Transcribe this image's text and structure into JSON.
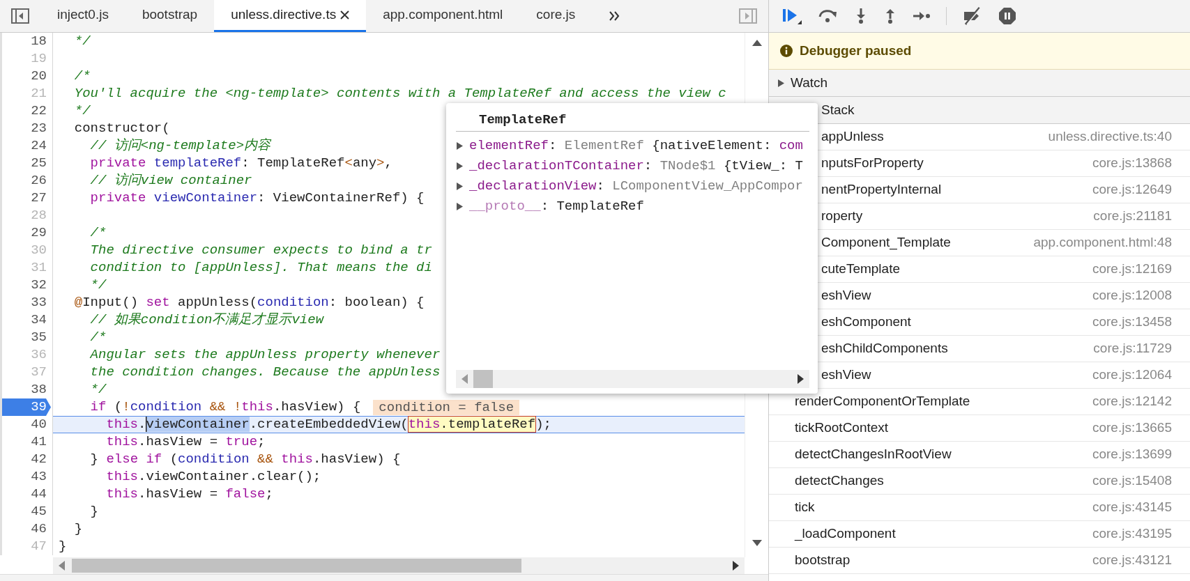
{
  "tabs": [
    {
      "label": "inject0.js",
      "selected": false,
      "closable": false
    },
    {
      "label": "bootstrap",
      "selected": false,
      "closable": false
    },
    {
      "label": "unless.directive.ts",
      "selected": true,
      "closable": true
    },
    {
      "label": "app.component.html",
      "selected": false,
      "closable": false
    },
    {
      "label": "core.js",
      "selected": false,
      "closable": false
    }
  ],
  "editor": {
    "lines": [
      {
        "number": "18",
        "breakable": true,
        "breakpoint": false,
        "paused_here": false,
        "tokens": [
          {
            "text": "  */",
            "kind": "comment"
          }
        ]
      },
      {
        "number": "19",
        "breakable": false,
        "breakpoint": false,
        "paused_here": false
      },
      {
        "number": "20",
        "breakable": true,
        "breakpoint": false,
        "paused_here": false,
        "tokens": [
          {
            "text": "  /*",
            "kind": "comment"
          }
        ]
      },
      {
        "number": "21",
        "breakable": false,
        "breakpoint": false,
        "paused_here": false,
        "tokens": [
          {
            "text": "  You'll acquire the <ng-template> contents with a TemplateRef and access the view c",
            "kind": "comment"
          }
        ]
      },
      {
        "number": "22",
        "breakable": true,
        "breakpoint": false,
        "paused_here": false,
        "tokens": [
          {
            "text": "  */",
            "kind": "comment"
          }
        ]
      },
      {
        "number": "23",
        "breakable": true,
        "breakpoint": false,
        "paused_here": false,
        "tokens": [
          {
            "text": "  constructor(",
            "kind": "plain"
          }
        ]
      },
      {
        "number": "24",
        "breakable": true,
        "breakpoint": false,
        "paused_here": false,
        "tokens": [
          {
            "text": "    // 访问<ng-template>内容",
            "kind": "comment"
          }
        ]
      },
      {
        "number": "25",
        "breakable": true,
        "breakpoint": false,
        "paused_here": false,
        "tokens": [
          {
            "text": "    private",
            "kind": "keyword"
          },
          {
            "text": " templateRef",
            "kind": "variable"
          },
          {
            "text": ": TemplateRef",
            "kind": "plain"
          },
          {
            "text": "<",
            "kind": "operator"
          },
          {
            "text": "any",
            "kind": "plain"
          },
          {
            "text": ">",
            "kind": "operator"
          },
          {
            "text": ",",
            "kind": "plain"
          }
        ]
      },
      {
        "number": "26",
        "breakable": true,
        "breakpoint": false,
        "paused_here": false,
        "tokens": [
          {
            "text": "    // 访问view container",
            "kind": "comment"
          }
        ]
      },
      {
        "number": "27",
        "breakable": true,
        "breakpoint": false,
        "paused_here": false,
        "tokens": [
          {
            "text": "    private",
            "kind": "keyword"
          },
          {
            "text": " viewContainer",
            "kind": "variable"
          },
          {
            "text": ": ViewContainerRef) {",
            "kind": "plain"
          }
        ]
      },
      {
        "number": "28",
        "breakable": false,
        "breakpoint": false,
        "paused_here": false
      },
      {
        "number": "29",
        "breakable": true,
        "breakpoint": false,
        "paused_here": false,
        "tokens": [
          {
            "text": "    /*",
            "kind": "comment"
          }
        ]
      },
      {
        "number": "30",
        "breakable": false,
        "breakpoint": false,
        "paused_here": false,
        "tokens": [
          {
            "text": "    The directive consumer expects to bind a tr",
            "kind": "comment"
          }
        ]
      },
      {
        "number": "31",
        "breakable": false,
        "breakpoint": false,
        "paused_here": false,
        "tokens": [
          {
            "text": "    condition to [appUnless]. That means the di",
            "kind": "comment"
          }
        ]
      },
      {
        "number": "32",
        "breakable": true,
        "breakpoint": false,
        "paused_here": false,
        "tokens": [
          {
            "text": "    */",
            "kind": "comment"
          }
        ]
      },
      {
        "number": "33",
        "breakable": true,
        "breakpoint": false,
        "paused_here": false,
        "tokens": [
          {
            "text": "  @",
            "kind": "operator"
          },
          {
            "text": "Input() ",
            "kind": "plain"
          },
          {
            "text": "set",
            "kind": "keyword"
          },
          {
            "text": " appUnless(",
            "kind": "plain"
          },
          {
            "text": "condition",
            "kind": "variable"
          },
          {
            "text": ": boolean) {",
            "kind": "plain"
          }
        ]
      },
      {
        "number": "34",
        "breakable": true,
        "breakpoint": false,
        "paused_here": false,
        "tokens": [
          {
            "text": "    // 如果condition不满足才显示view",
            "kind": "comment"
          }
        ]
      },
      {
        "number": "35",
        "breakable": true,
        "breakpoint": false,
        "paused_here": false,
        "tokens": [
          {
            "text": "    /*",
            "kind": "comment"
          }
        ]
      },
      {
        "number": "36",
        "breakable": false,
        "breakpoint": false,
        "paused_here": false,
        "tokens": [
          {
            "text": "    Angular sets the appUnless property whenever",
            "kind": "comment"
          }
        ]
      },
      {
        "number": "37",
        "breakable": false,
        "breakpoint": false,
        "paused_here": false,
        "tokens": [
          {
            "text": "    the condition changes. Because the appUnless",
            "kind": "comment"
          }
        ]
      },
      {
        "number": "38",
        "breakable": true,
        "breakpoint": false,
        "paused_here": false,
        "tokens": [
          {
            "text": "    */",
            "kind": "comment"
          }
        ]
      },
      {
        "number": "39",
        "breakable": true,
        "breakpoint": true,
        "paused_here": false,
        "tokens": [
          {
            "text": "    if",
            "kind": "keyword"
          },
          {
            "text": " (",
            "kind": "plain"
          },
          {
            "text": "!",
            "kind": "operator"
          },
          {
            "text": "condition",
            "kind": "variable"
          },
          {
            "text": " &&",
            "kind": "operator"
          },
          {
            "text": " !",
            "kind": "operator"
          },
          {
            "text": "this",
            "kind": "keyword"
          },
          {
            "text": ".hasView) {",
            "kind": "plain"
          }
        ],
        "inline_value": "condition = false"
      },
      {
        "number": "40",
        "breakable": true,
        "breakpoint": false,
        "paused_here": true,
        "tokens": [
          {
            "text": "      this",
            "kind": "keyword"
          },
          {
            "text": ".",
            "kind": "plain"
          },
          {
            "text": "viewContainer",
            "kind": "plain",
            "selected": true
          },
          {
            "text": ".createEmbeddedView(",
            "kind": "plain"
          },
          {
            "kind": "group",
            "hovered": true,
            "tokens": [
              {
                "text": "this",
                "kind": "keyword"
              },
              {
                "text": ".templateRef",
                "kind": "plain"
              }
            ]
          },
          {
            "text": ");",
            "kind": "plain"
          }
        ]
      },
      {
        "number": "41",
        "breakable": true,
        "breakpoint": false,
        "paused_here": false,
        "tokens": [
          {
            "text": "      this",
            "kind": "keyword"
          },
          {
            "text": ".hasView = ",
            "kind": "plain"
          },
          {
            "text": "true",
            "kind": "keyword"
          },
          {
            "text": ";",
            "kind": "plain"
          }
        ]
      },
      {
        "number": "42",
        "breakable": true,
        "breakpoint": false,
        "paused_here": false,
        "tokens": [
          {
            "text": "    } ",
            "kind": "plain"
          },
          {
            "text": "else",
            "kind": "keyword"
          },
          {
            "text": " if",
            "kind": "keyword"
          },
          {
            "text": " (",
            "kind": "plain"
          },
          {
            "text": "condition",
            "kind": "variable"
          },
          {
            "text": " &&",
            "kind": "operator"
          },
          {
            "text": " this",
            "kind": "keyword"
          },
          {
            "text": ".hasView) {",
            "kind": "plain"
          }
        ]
      },
      {
        "number": "43",
        "breakable": true,
        "breakpoint": false,
        "paused_here": false,
        "tokens": [
          {
            "text": "      this",
            "kind": "keyword"
          },
          {
            "text": ".viewContainer.clear();",
            "kind": "plain"
          }
        ]
      },
      {
        "number": "44",
        "breakable": true,
        "breakpoint": false,
        "paused_here": false,
        "tokens": [
          {
            "text": "      this",
            "kind": "keyword"
          },
          {
            "text": ".hasView = ",
            "kind": "plain"
          },
          {
            "text": "false",
            "kind": "keyword"
          },
          {
            "text": ";",
            "kind": "plain"
          }
        ]
      },
      {
        "number": "45",
        "breakable": true,
        "breakpoint": false,
        "paused_here": false,
        "tokens": [
          {
            "text": "    }",
            "kind": "plain"
          }
        ]
      },
      {
        "number": "46",
        "breakable": true,
        "breakpoint": false,
        "paused_here": false,
        "tokens": [
          {
            "text": "  }",
            "kind": "plain"
          }
        ]
      },
      {
        "number": "47",
        "breakable": false,
        "breakpoint": false,
        "paused_here": false,
        "tokens": [
          {
            "text": "}",
            "kind": "plain"
          }
        ]
      }
    ]
  },
  "popover": {
    "title": "TemplateRef",
    "properties": [
      {
        "name": "elementRef",
        "kind": "own",
        "expanded": false,
        "value": [
          {
            "text": ": ",
            "kind": "plain"
          },
          {
            "text": "ElementRef ",
            "kind": "type"
          },
          {
            "text": "{nativeElement: ",
            "kind": "plain"
          },
          {
            "text": "com",
            "kind": "key"
          }
        ]
      },
      {
        "name": "_declarationTContainer",
        "kind": "own",
        "expanded": false,
        "value": [
          {
            "text": ": ",
            "kind": "plain"
          },
          {
            "text": "TNode$1 ",
            "kind": "type"
          },
          {
            "text": "{tView_: T",
            "kind": "plain"
          }
        ]
      },
      {
        "name": "_declarationView",
        "kind": "own",
        "expanded": false,
        "value": [
          {
            "text": ": ",
            "kind": "plain"
          },
          {
            "text": "LComponentView_AppCompor",
            "kind": "type"
          }
        ]
      },
      {
        "name": "__proto__",
        "kind": "proto",
        "expanded": false,
        "value": [
          {
            "text": ": ",
            "kind": "plain"
          },
          {
            "text": "TemplateRef",
            "kind": "plain"
          }
        ]
      }
    ]
  },
  "debugger": {
    "status": "Debugger paused",
    "watch": {
      "label": "Watch",
      "expanded": false
    },
    "call_stack": {
      "label": "Stack",
      "frames": [
        {
          "name": "appUnless",
          "location": "unless.directive.ts:40",
          "partly_hidden": true
        },
        {
          "name": "nputsForProperty",
          "location": "core.js:13868",
          "partly_hidden": true
        },
        {
          "name": "nentPropertyInternal",
          "location": "core.js:12649",
          "partly_hidden": true
        },
        {
          "name": "roperty",
          "location": "core.js:21181",
          "partly_hidden": true
        },
        {
          "name": "Component_Template",
          "location": "app.component.html:48",
          "partly_hidden": true
        },
        {
          "name": "cuteTemplate",
          "location": "core.js:12169",
          "partly_hidden": true
        },
        {
          "name": "eshView",
          "location": "core.js:12008",
          "partly_hidden": true
        },
        {
          "name": "eshComponent",
          "location": "core.js:13458",
          "partly_hidden": true
        },
        {
          "name": "eshChildComponents",
          "location": "core.js:11729",
          "partly_hidden": true
        },
        {
          "name": "eshView",
          "location": "core.js:12064",
          "partly_hidden": true
        },
        {
          "name": "renderComponentOrTemplate",
          "location": "core.js:12142"
        },
        {
          "name": "tickRootContext",
          "location": "core.js:13665"
        },
        {
          "name": "detectChangesInRootView",
          "location": "core.js:13699"
        },
        {
          "name": "detectChanges",
          "location": "core.js:15408"
        },
        {
          "name": "tick",
          "location": "core.js:43145"
        },
        {
          "name": "_loadComponent",
          "location": "core.js:43195"
        },
        {
          "name": "bootstrap",
          "location": "core.js:43121"
        }
      ]
    }
  }
}
